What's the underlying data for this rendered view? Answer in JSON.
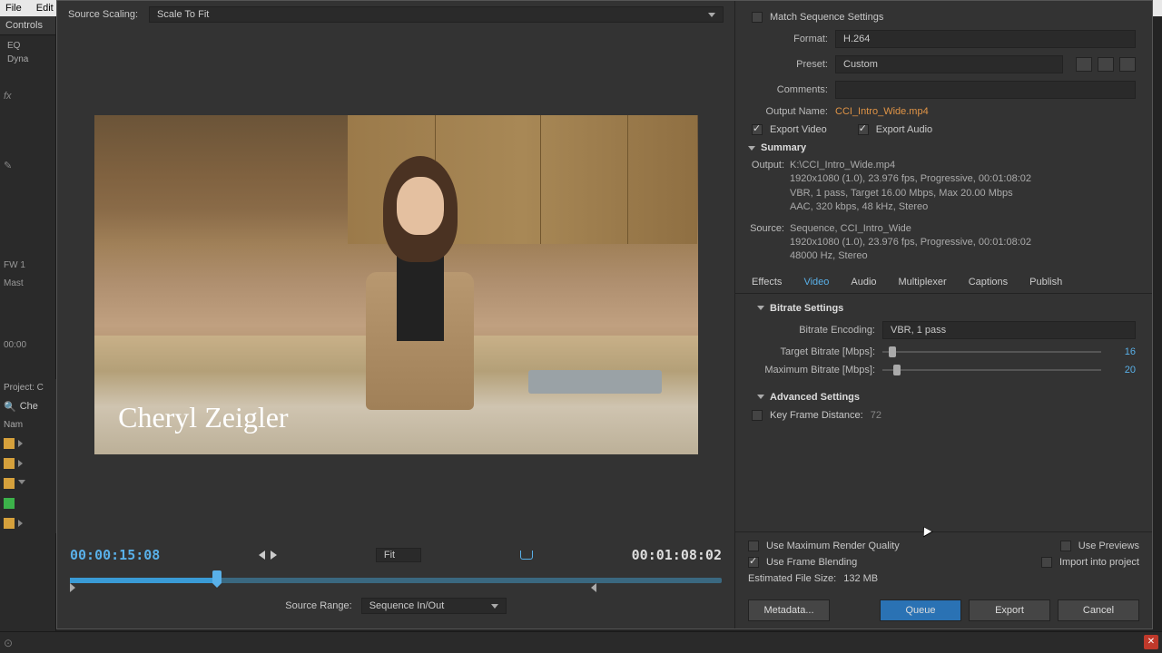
{
  "menubar": {
    "file": "File",
    "edit": "Edit"
  },
  "leftrail": {
    "controls": "Controls",
    "eq": "EQ",
    "dyn": "Dyna",
    "fw": "FW 1",
    "mast": "Mast",
    "tc": "00:00",
    "project": "Project: C",
    "search": "Che",
    "name_hdr": "Nam",
    "rows": [
      {
        "color": "#d6a13c"
      },
      {
        "color": "#d6a13c"
      },
      {
        "color": "#d6a13c"
      },
      {
        "color": "#3cb24a"
      },
      {
        "color": "#d6a13c"
      }
    ]
  },
  "source_scaling": {
    "label": "Source Scaling:",
    "value": "Scale To Fit"
  },
  "preview": {
    "lower_third": "Cheryl Zeigler"
  },
  "timebar": {
    "current": "00:00:15:08",
    "duration": "00:01:08:02",
    "fit": "Fit"
  },
  "source_range": {
    "label": "Source Range:",
    "value": "Sequence In/Out"
  },
  "export": {
    "match": "Match Sequence Settings",
    "format_lbl": "Format:",
    "format_val": "H.264",
    "preset_lbl": "Preset:",
    "preset_val": "Custom",
    "comments_lbl": "Comments:",
    "outputname_lbl": "Output Name:",
    "outputname_val": "CCI_Intro_Wide.mp4",
    "export_video": "Export Video",
    "export_audio": "Export Audio",
    "summary_hdr": "Summary",
    "output_lbl": "Output:",
    "output_l1": "K:\\CCI_Intro_Wide.mp4",
    "output_l2": "1920x1080 (1.0), 23.976 fps, Progressive, 00:01:08:02",
    "output_l3": "VBR, 1 pass, Target 16.00 Mbps, Max 20.00 Mbps",
    "output_l4": "AAC, 320 kbps, 48 kHz, Stereo",
    "source_lbl": "Source:",
    "source_l1": "Sequence, CCI_Intro_Wide",
    "source_l2": "1920x1080 (1.0), 23.976 fps, Progressive, 00:01:08:02",
    "source_l3": "48000 Hz, Stereo"
  },
  "tabs": {
    "effects": "Effects",
    "video": "Video",
    "audio": "Audio",
    "mux": "Multiplexer",
    "captions": "Captions",
    "publish": "Publish"
  },
  "bitrate": {
    "hdr": "Bitrate Settings",
    "enc_lbl": "Bitrate Encoding:",
    "enc_val": "VBR, 1 pass",
    "target_lbl": "Target Bitrate [Mbps]:",
    "target_val": "16",
    "max_lbl": "Maximum Bitrate [Mbps]:",
    "max_val": "20"
  },
  "advanced": {
    "hdr": "Advanced Settings",
    "kfd_lbl": "Key Frame Distance:",
    "kfd_val": "72"
  },
  "footer": {
    "maxrender": "Use Maximum Render Quality",
    "previews": "Use Previews",
    "blending": "Use Frame Blending",
    "import": "Import into project",
    "est_lbl": "Estimated File Size:",
    "est_val": "132 MB",
    "metadata": "Metadata...",
    "queue": "Queue",
    "export": "Export",
    "cancel": "Cancel"
  }
}
